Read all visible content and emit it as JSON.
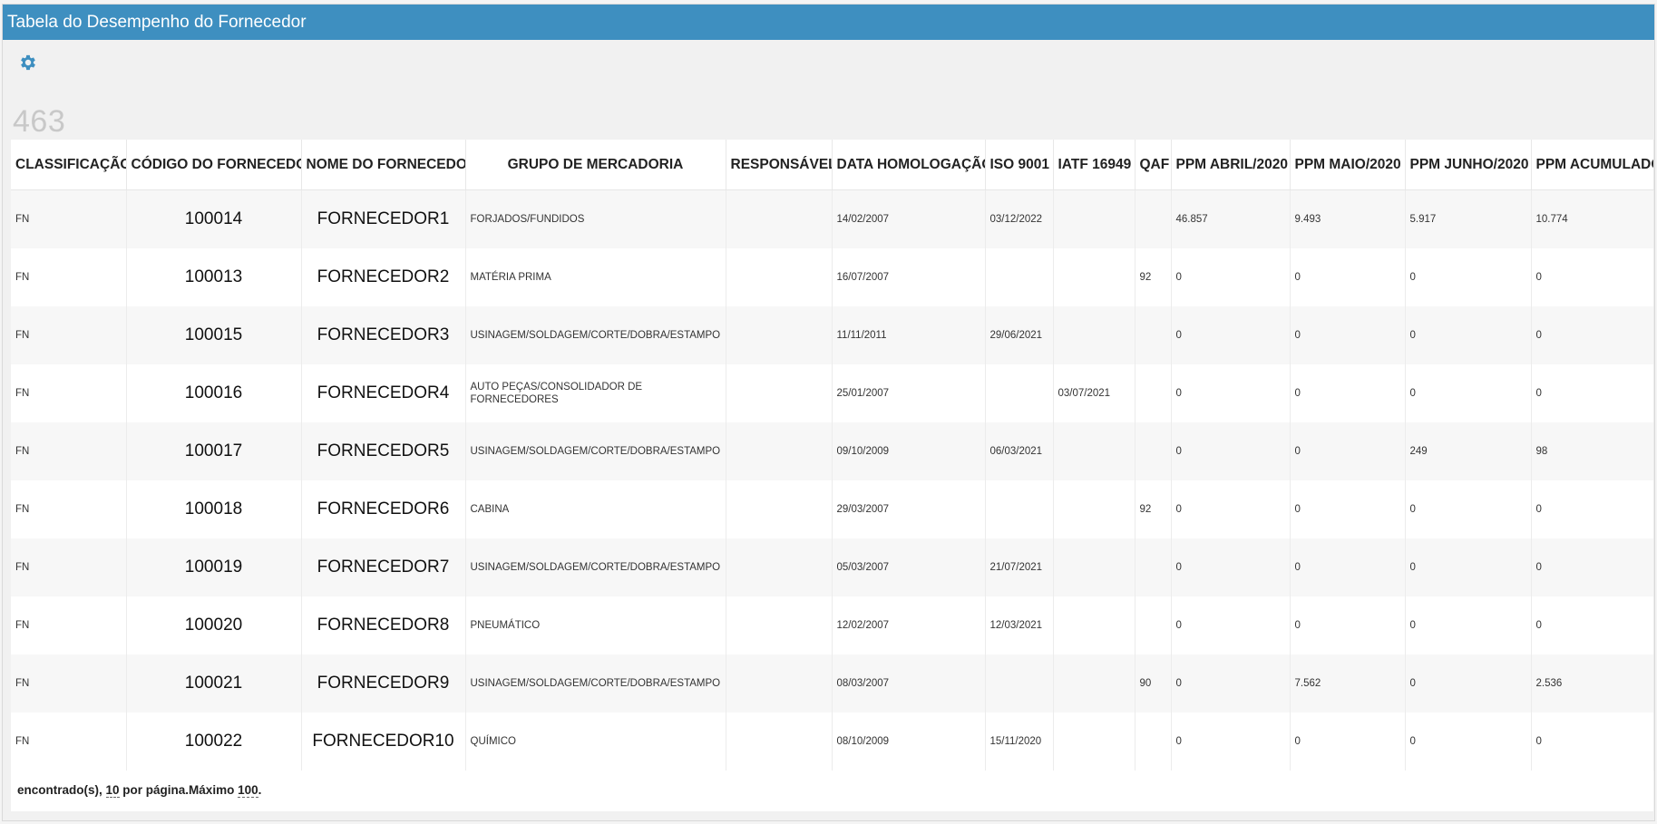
{
  "window": {
    "title": "Tabela do Desempenho do Fornecedor"
  },
  "toolbar": {
    "icon": "gear-icon",
    "accent": "#3e8fc0"
  },
  "summary": {
    "count": "463"
  },
  "table": {
    "columns": [
      "CLASSIFICAÇÃO",
      "CÓDIGO DO FORNECEDOR",
      "NOME DO FORNECEDOR",
      "GRUPO DE MERCADORIA",
      "RESPONSÁVEL",
      "DATA HOMOLOGAÇÃO",
      "ISO 9001",
      "IATF 16949",
      "QAF",
      "PPM ABRIL/2020",
      "PPM MAIO/2020",
      "PPM JUNHO/2020",
      "PPM ACUMULADO"
    ],
    "rows": [
      [
        "FN",
        "100014",
        "FORNECEDOR1",
        "FORJADOS/FUNDIDOS",
        "",
        "14/02/2007",
        "03/12/2022",
        "",
        "",
        "46.857",
        "9.493",
        "5.917",
        "10.774"
      ],
      [
        "FN",
        "100013",
        "FORNECEDOR2",
        "MATÉRIA PRIMA",
        "",
        "16/07/2007",
        "",
        "",
        "92",
        "0",
        "0",
        "0",
        "0"
      ],
      [
        "FN",
        "100015",
        "FORNECEDOR3",
        "USINAGEM/SOLDAGEM/CORTE/DOBRA/ESTAMPO",
        "",
        "11/11/2011",
        "29/06/2021",
        "",
        "",
        "0",
        "0",
        "0",
        "0"
      ],
      [
        "FN",
        "100016",
        "FORNECEDOR4",
        "AUTO PEÇAS/CONSOLIDADOR DE FORNECEDORES",
        "",
        "25/01/2007",
        "",
        "03/07/2021",
        "",
        "0",
        "0",
        "0",
        "0"
      ],
      [
        "FN",
        "100017",
        "FORNECEDOR5",
        "USINAGEM/SOLDAGEM/CORTE/DOBRA/ESTAMPO",
        "",
        "09/10/2009",
        "06/03/2021",
        "",
        "",
        "0",
        "0",
        "249",
        "98"
      ],
      [
        "FN",
        "100018",
        "FORNECEDOR6",
        "CABINA",
        "",
        "29/03/2007",
        "",
        "",
        "92",
        "0",
        "0",
        "0",
        "0"
      ],
      [
        "FN",
        "100019",
        "FORNECEDOR7",
        "USINAGEM/SOLDAGEM/CORTE/DOBRA/ESTAMPO",
        "",
        "05/03/2007",
        "21/07/2021",
        "",
        "",
        "0",
        "0",
        "0",
        "0"
      ],
      [
        "FN",
        "100020",
        "FORNECEDOR8",
        "PNEUMÁTICO",
        "",
        "12/02/2007",
        "12/03/2021",
        "",
        "",
        "0",
        "0",
        "0",
        "0"
      ],
      [
        "FN",
        "100021",
        "FORNECEDOR9",
        "USINAGEM/SOLDAGEM/CORTE/DOBRA/ESTAMPO",
        "",
        "08/03/2007",
        "",
        "",
        "90",
        "0",
        "7.562",
        "0",
        "2.536"
      ],
      [
        "FN",
        "100022",
        "FORNECEDOR10",
        "QUÍMICO",
        "",
        "08/10/2009",
        "15/11/2020",
        "",
        "",
        "0",
        "0",
        "0",
        "0"
      ]
    ]
  },
  "footer": {
    "text_a": "encontrado(s), ",
    "per_page": "10",
    "text_b": " por página.Máximo ",
    "max": "100",
    "text_c": "."
  }
}
